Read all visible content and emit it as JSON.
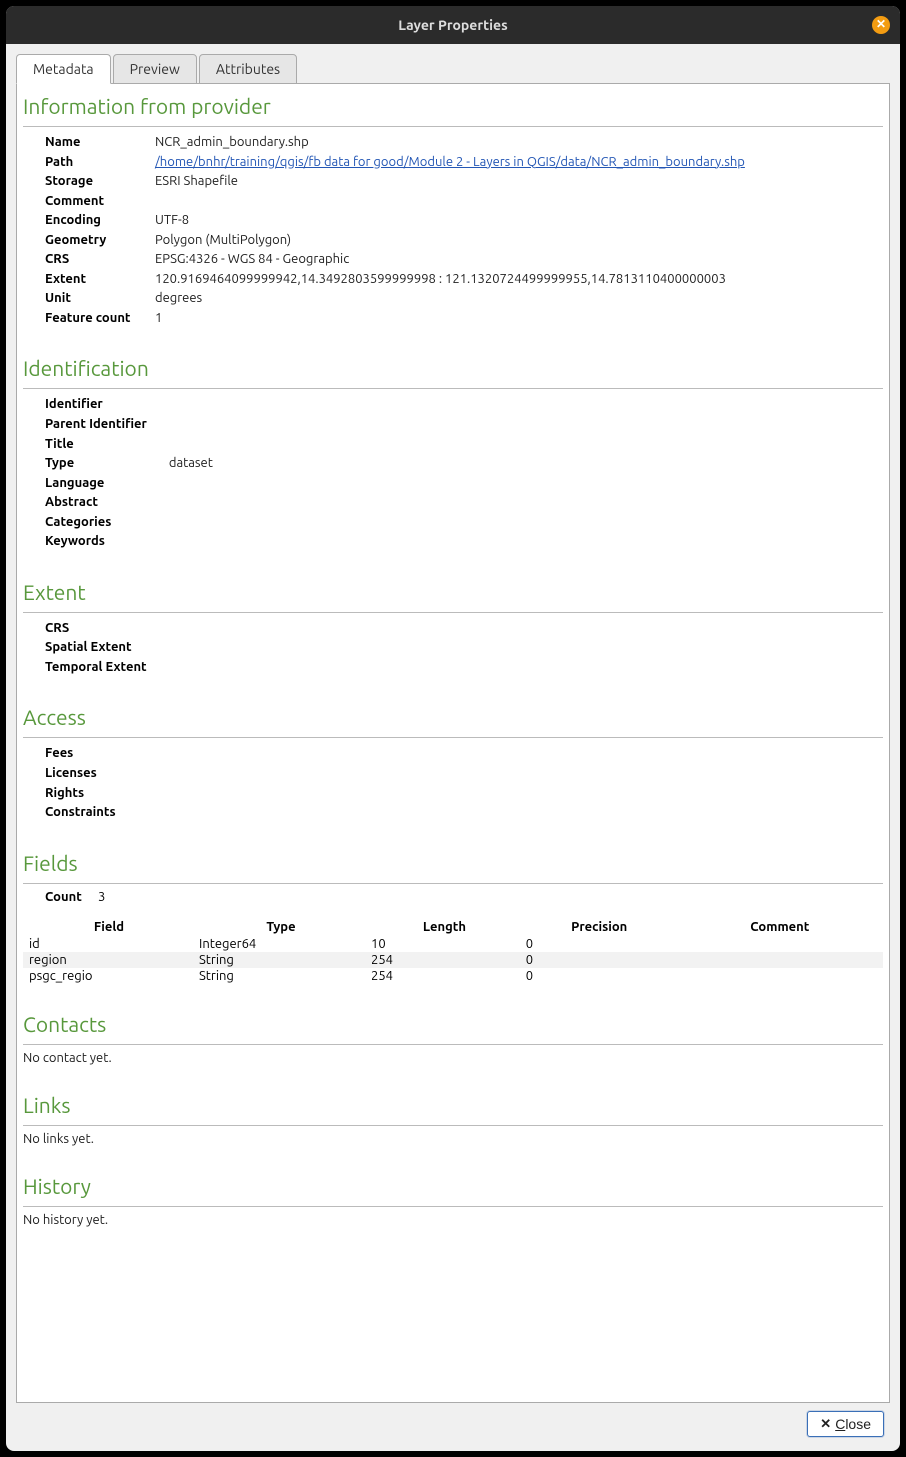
{
  "window": {
    "title": "Layer Properties"
  },
  "tabs": {
    "metadata": "Metadata",
    "preview": "Preview",
    "attributes": "Attributes"
  },
  "sections": {
    "info_provider": "Information from provider",
    "identification": "Identification",
    "extent": "Extent",
    "access": "Access",
    "fields": "Fields",
    "contacts": "Contacts",
    "links": "Links",
    "history": "History"
  },
  "provider": {
    "labels": {
      "name": "Name",
      "path": "Path",
      "storage": "Storage",
      "comment": "Comment",
      "encoding": "Encoding",
      "geometry": "Geometry",
      "crs": "CRS",
      "extent": "Extent",
      "unit": "Unit",
      "feature_count": "Feature count"
    },
    "name": "NCR_admin_boundary.shp",
    "path": "/home/bnhr/training/qgis/fb data for good/Module 2 - Layers in QGIS/data/NCR_admin_boundary.shp",
    "storage": "ESRI Shapefile",
    "comment": "",
    "encoding": "UTF-8",
    "geometry": "Polygon (MultiPolygon)",
    "crs": "EPSG:4326 - WGS 84 - Geographic",
    "extent": "120.9169464099999942,14.3492803599999998 : 121.1320724499999955,14.7813110400000003",
    "unit": "degrees",
    "feature_count": "1"
  },
  "identification": {
    "labels": {
      "identifier": "Identifier",
      "parent_identifier": "Parent Identifier",
      "title": "Title",
      "type": "Type",
      "language": "Language",
      "abstract": "Abstract",
      "categories": "Categories",
      "keywords": "Keywords"
    },
    "type": "dataset"
  },
  "extent_block": {
    "labels": {
      "crs": "CRS",
      "spatial": "Spatial Extent",
      "temporal": "Temporal Extent"
    }
  },
  "access_block": {
    "labels": {
      "fees": "Fees",
      "licenses": "Licenses",
      "rights": "Rights",
      "constraints": "Constraints"
    }
  },
  "fields_block": {
    "count_label": "Count",
    "count": "3",
    "headers": {
      "field": "Field",
      "type": "Type",
      "length": "Length",
      "precision": "Precision",
      "comment": "Comment"
    },
    "rows": [
      {
        "field": "id",
        "type": "Integer64",
        "length": "10",
        "precision": "0",
        "comment": ""
      },
      {
        "field": "region",
        "type": "String",
        "length": "254",
        "precision": "0",
        "comment": ""
      },
      {
        "field": "psgc_regio",
        "type": "String",
        "length": "254",
        "precision": "0",
        "comment": ""
      }
    ]
  },
  "contacts_msg": "No contact yet.",
  "links_msg": "No links yet.",
  "history_msg": "No history yet.",
  "buttons": {
    "close": "Close",
    "close_prefix": ""
  }
}
